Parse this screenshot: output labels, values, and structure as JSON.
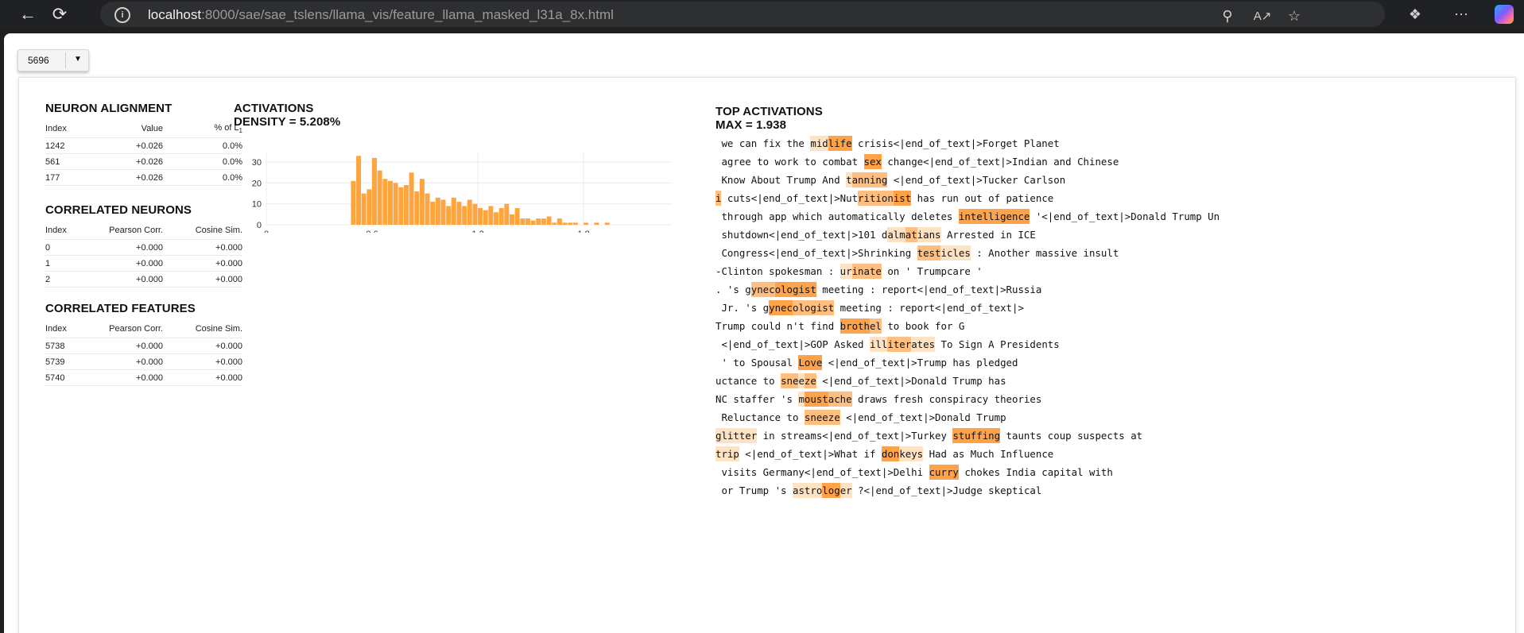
{
  "browser": {
    "url_host": "localhost",
    "url_path": ":8000/sae/sae_tslens/llama_vis/feature_llama_masked_l31a_8x.html"
  },
  "selector": {
    "value": "5696"
  },
  "neuron_alignment": {
    "title": "NEURON ALIGNMENT",
    "headers": [
      "Index",
      "Value",
      "% of L"
    ],
    "header_sub": "1",
    "rows": [
      [
        "1242",
        "+0.026",
        "0.0%"
      ],
      [
        "561",
        "+0.026",
        "0.0%"
      ],
      [
        "177",
        "+0.026",
        "0.0%"
      ]
    ]
  },
  "correlated_neurons": {
    "title": "CORRELATED NEURONS",
    "headers": [
      "Index",
      "Pearson Corr.",
      "Cosine Sim."
    ],
    "rows": [
      [
        "0",
        "+0.000",
        "+0.000"
      ],
      [
        "1",
        "+0.000",
        "+0.000"
      ],
      [
        "2",
        "+0.000",
        "+0.000"
      ]
    ]
  },
  "correlated_features": {
    "title": "CORRELATED FEATURES",
    "headers": [
      "Index",
      "Pearson Corr.",
      "Cosine Sim."
    ],
    "rows": [
      [
        "5738",
        "+0.000",
        "+0.000"
      ],
      [
        "5739",
        "+0.000",
        "+0.000"
      ],
      [
        "5740",
        "+0.000",
        "+0.000"
      ]
    ]
  },
  "activations": {
    "title": "ACTIVATIONS",
    "density": "DENSITY = 5.208%"
  },
  "chart_data": {
    "type": "bar",
    "title": "",
    "xlabel": "",
    "ylabel": "",
    "xlim": [
      0,
      2.3
    ],
    "ylim": [
      0,
      35
    ],
    "xticks": [
      "0",
      "0.6",
      "1.2",
      "1.8"
    ],
    "yticks": [
      "0",
      "10",
      "20",
      "30"
    ],
    "grid": true,
    "bin_width": 0.027,
    "color": "#ffa53f",
    "bins_x": [
      0.48,
      0.51,
      0.54,
      0.57,
      0.6,
      0.63,
      0.66,
      0.69,
      0.72,
      0.75,
      0.78,
      0.81,
      0.84,
      0.87,
      0.9,
      0.93,
      0.96,
      0.99,
      1.02,
      1.05,
      1.08,
      1.11,
      1.14,
      1.17,
      1.2,
      1.23,
      1.26,
      1.29,
      1.32,
      1.35,
      1.38,
      1.41,
      1.44,
      1.47,
      1.5,
      1.53,
      1.56,
      1.59,
      1.62,
      1.65,
      1.68,
      1.71,
      1.74,
      1.8,
      1.86,
      1.92
    ],
    "values": [
      21,
      33,
      15,
      17,
      32,
      26,
      22,
      21,
      20,
      18,
      19,
      25,
      16,
      22,
      15,
      11,
      13,
      12,
      9,
      13,
      11,
      9,
      12,
      10,
      8,
      7,
      9,
      6,
      8,
      10,
      5,
      8,
      3,
      3,
      2,
      3,
      3,
      4,
      1,
      3,
      1,
      1,
      1,
      1,
      1,
      1
    ]
  },
  "top_activations": {
    "title": "TOP ACTIVATIONS",
    "max": "MAX = 1.938",
    "examples": [
      [
        [
          " we can fix the ",
          0
        ],
        [
          "mid",
          1
        ],
        [
          "life",
          3
        ],
        [
          " crisis<|end_of_text|>Forget Planet",
          0
        ]
      ],
      [
        [
          " agree to work to combat ",
          0
        ],
        [
          "sex",
          3
        ],
        [
          " change<|end_of_text|>Indian and Chinese",
          0
        ]
      ],
      [
        [
          " Know About Trump And ",
          0
        ],
        [
          "t",
          1
        ],
        [
          "anning",
          2
        ],
        [
          " <|end_of_text|>Tucker Carlson",
          0
        ]
      ],
      [
        [
          "i",
          2
        ],
        [
          " cuts<|end_of_text|>Nut",
          0
        ],
        [
          "rition",
          2
        ],
        [
          "ist",
          3
        ],
        [
          " has run out of patience",
          0
        ]
      ],
      [
        [
          " through app which automatically deletes ",
          0
        ],
        [
          "intelligence",
          3
        ],
        [
          " '<|end_of_text|>Donald Trump Un",
          0
        ]
      ],
      [
        [
          " shutdown<|end_of_text|>101 d",
          0
        ],
        [
          "alm",
          1
        ],
        [
          "at",
          2
        ],
        [
          "ians",
          1
        ],
        [
          " Arrested in ICE",
          0
        ]
      ],
      [
        [
          " Congress<|end_of_text|>Shrinking ",
          0
        ],
        [
          "test",
          2
        ],
        [
          "icles",
          1
        ],
        [
          " : Another massive insult",
          0
        ]
      ],
      [
        [
          "-Clinton spokesman : ",
          0
        ],
        [
          "ur",
          1
        ],
        [
          "inate",
          2
        ],
        [
          " on ' Trumpcare '",
          0
        ]
      ],
      [
        [
          ". 's g",
          0
        ],
        [
          "ynec",
          2
        ],
        [
          "ologist",
          3
        ],
        [
          " meeting : report<|end_of_text|>Russia",
          0
        ]
      ],
      [
        [
          " Jr. 's g",
          0
        ],
        [
          "ynec",
          3
        ],
        [
          "ologist",
          2
        ],
        [
          " meeting : report<|end_of_text|>",
          0
        ]
      ],
      [
        [
          "Trump could n't find ",
          0
        ],
        [
          "broth",
          3
        ],
        [
          "el",
          2
        ],
        [
          " to book for G",
          0
        ]
      ],
      [
        [
          " <|end_of_text|>GOP Asked ",
          0
        ],
        [
          "ill",
          1
        ],
        [
          "iter",
          2
        ],
        [
          "ates",
          1
        ],
        [
          " To Sign A Presidents",
          0
        ]
      ],
      [
        [
          " ' to Spousal ",
          0
        ],
        [
          "Love",
          3
        ],
        [
          " <|end_of_text|>Trump has pledged",
          0
        ]
      ],
      [
        [
          "uctance to ",
          0
        ],
        [
          "sne",
          2
        ],
        [
          "e",
          1
        ],
        [
          "ze",
          2
        ],
        [
          " <|end_of_text|>Donald Trump has",
          0
        ]
      ],
      [
        [
          "NC staffer 's ",
          0
        ],
        [
          "m",
          1
        ],
        [
          "oust",
          3
        ],
        [
          "ache",
          2
        ],
        [
          " draws fresh conspiracy theories",
          0
        ]
      ],
      [
        [
          " Reluctance to ",
          0
        ],
        [
          "sne",
          2
        ],
        [
          "e",
          2
        ],
        [
          "ze",
          2
        ],
        [
          " <|end_of_text|>Donald Trump",
          0
        ]
      ],
      [
        [
          "glitter",
          1
        ],
        [
          " in streams<|end_of_text|>Turkey ",
          0
        ],
        [
          "stuffing",
          3
        ],
        [
          " taunts coup suspects at",
          0
        ]
      ],
      [
        [
          "trip",
          1
        ],
        [
          " <|end_of_text|>What if ",
          0
        ],
        [
          "don",
          3
        ],
        [
          "keys",
          1
        ],
        [
          " Had as Much Influence",
          0
        ]
      ],
      [
        [
          " visits Germany<|end_of_text|>Delhi ",
          0
        ],
        [
          "curry",
          3
        ],
        [
          " chokes India capital with",
          0
        ]
      ],
      [
        [
          " or Trump 's ",
          0
        ],
        [
          "astro",
          1
        ],
        [
          "log",
          3
        ],
        [
          "er",
          1
        ],
        [
          " ?<|end_of_text|>Judge skeptical",
          0
        ]
      ]
    ]
  },
  "highlight_colors": [
    "transparent",
    "#fde2c4",
    "#ffbf80",
    "#ffa34a"
  ]
}
